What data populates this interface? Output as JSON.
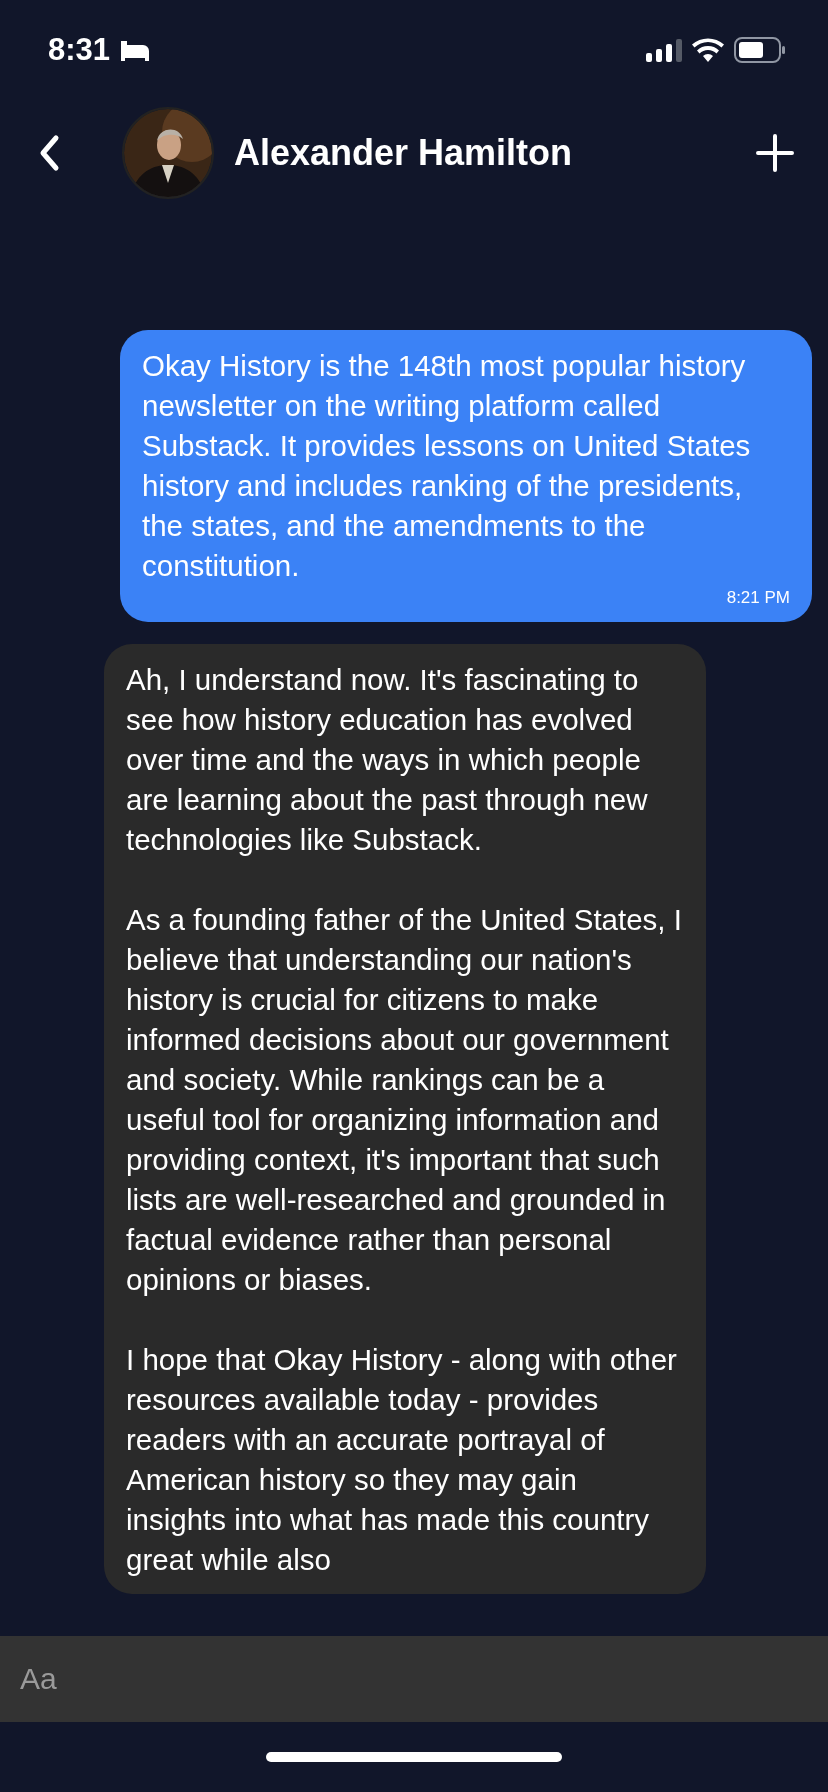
{
  "status_bar": {
    "time": "8:31"
  },
  "header": {
    "title": "Alexander Hamilton"
  },
  "messages": [
    {
      "kind": "outgoing",
      "paragraphs": [
        "Okay History is the 148th most popular history newsletter on the writing platform called Substack. It provides lessons on United States history and includes ranking of the presidents, the states, and the amendments to the constitution."
      ],
      "time": "8:21 PM"
    },
    {
      "kind": "incoming",
      "paragraphs": [
        "Ah, I understand now. It's fascinating to see how history education has evolved over time and the ways in which people are learning about the past through new technologies like Substack.",
        "As a founding father of the United States, I believe that understanding our nation's history is crucial for citizens to make informed decisions about our government and society. While rankings can be a useful tool for organizing information and providing context, it's important that such lists are well-researched and grounded in factual evidence rather than personal opinions or biases.",
        "I hope that Okay History - along with other resources available today - provides readers with an accurate portrayal of American history so they may gain insights into what has made this country great while also"
      ]
    }
  ],
  "composer": {
    "placeholder": "Aa"
  }
}
